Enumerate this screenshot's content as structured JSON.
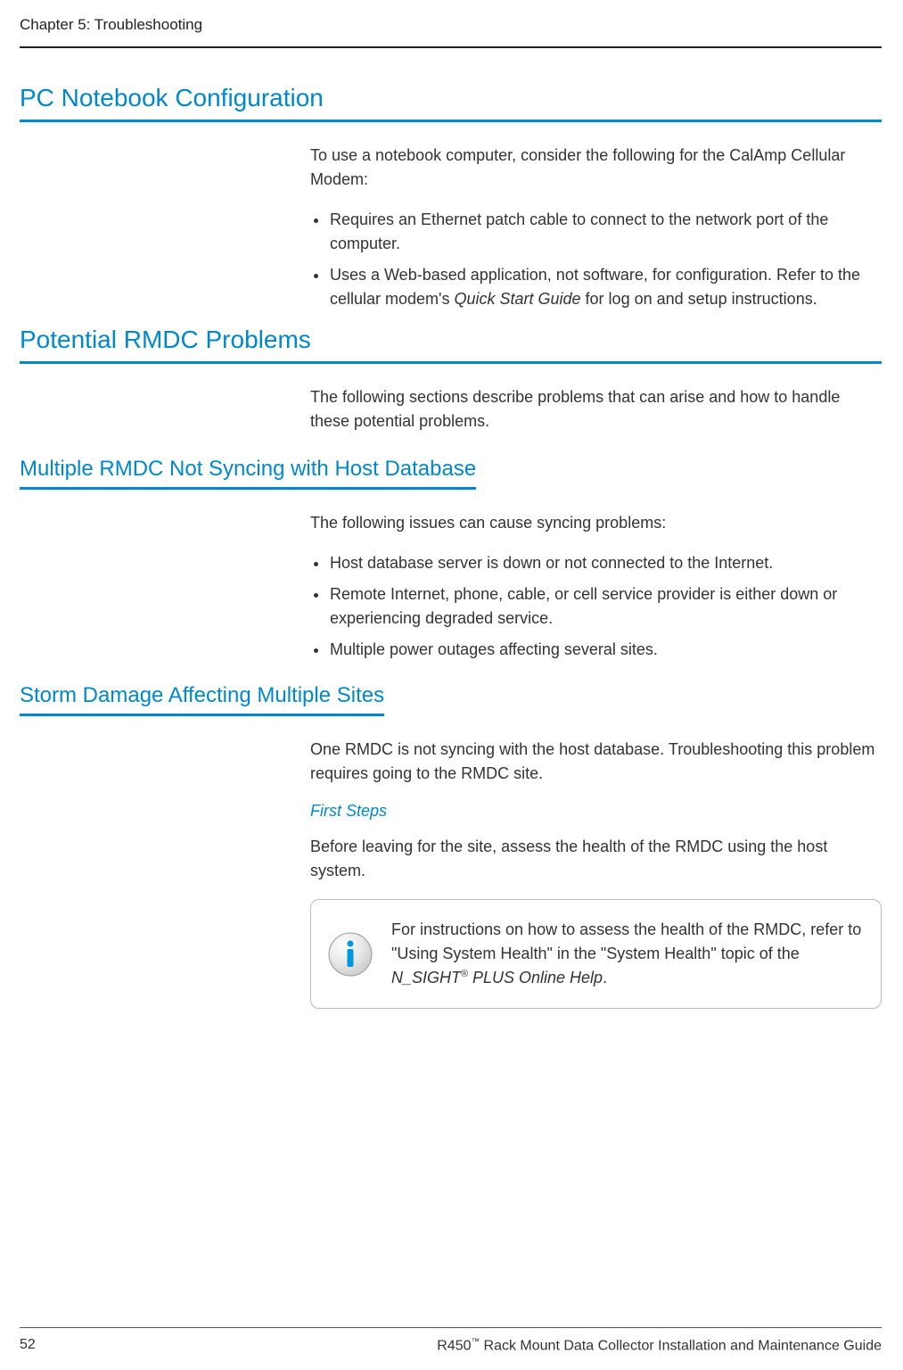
{
  "chapter": "Chapter 5: Troubleshooting",
  "section1": {
    "title": "PC Notebook Configuration",
    "intro": "To use a notebook computer, consider the following for the CalAmp Cellular Modem:",
    "bullets": [
      "Requires an Ethernet patch cable to connect to the network port of the computer.",
      {
        "pre": "Uses a Web-based application, not software, for configuration. Refer to the cellular modem's ",
        "em": "Quick Start Guide",
        "post": " for log on and setup instructions."
      }
    ]
  },
  "section2": {
    "title": "Potential RMDC Problems",
    "intro": "The following sections describe problems that can arise and how to handle these potential problems."
  },
  "section3": {
    "title": "Multiple RMDC Not Syncing with Host Database",
    "intro": "The following issues can cause syncing problems:",
    "bullets": [
      "Host database server is down or not connected to the Internet.",
      "Remote Internet, phone, cable, or cell service provider is either down or experiencing degraded service.",
      "Multiple power outages affecting several sites."
    ]
  },
  "section4": {
    "title": "Storm Damage Affecting Multiple Sites",
    "intro": "One RMDC is not syncing with the host database. Troubleshooting this problem requires going to the RMDC site.",
    "subhead": "First Steps",
    "body2": "Before leaving for the site, assess the health of the RMDC using the host system.",
    "info": {
      "pre": "For instructions on how to assess the health of the RMDC, refer to \"Using System Health\" in the \"System Health\" topic of the ",
      "em1": "N_SIGHT",
      "sup": "®",
      "em2": " PLUS Online Help",
      "post": "."
    }
  },
  "footer": {
    "page": "52",
    "doc_pre": "R450",
    "doc_sup": "™",
    "doc_post": " Rack Mount Data Collector Installation and Maintenance Guide"
  }
}
